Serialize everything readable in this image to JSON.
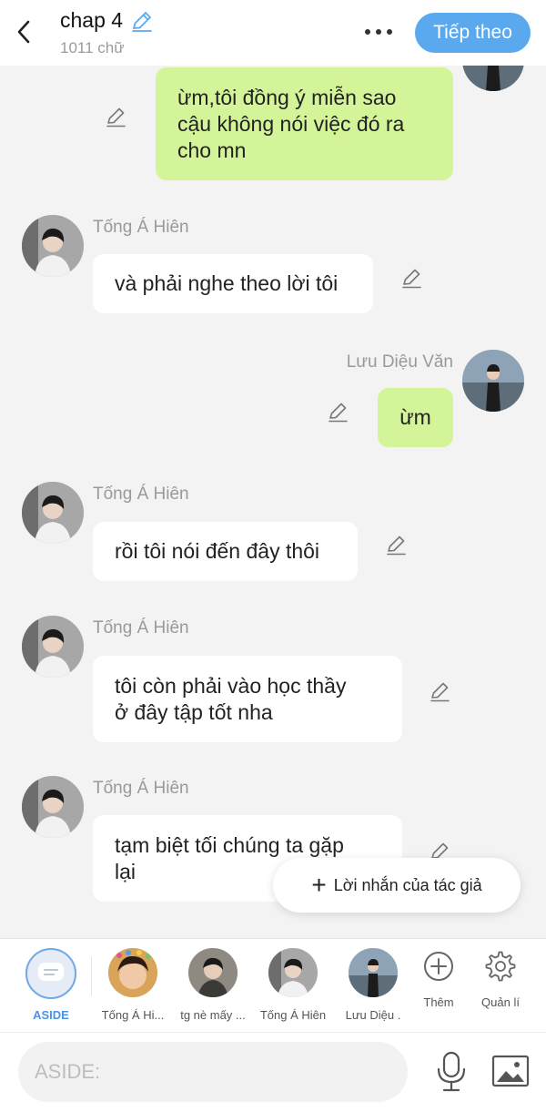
{
  "header": {
    "title": "chap 4",
    "word_count": "1011 chữ",
    "next_label": "Tiếp theo"
  },
  "messages": [
    {
      "side": "right",
      "sender": "",
      "text": "ừm,tôi đồng ý miễn sao\ncậu không nói việc đó ra\ncho mn"
    },
    {
      "side": "left",
      "sender": "Tống Á Hiên",
      "text": "và phải nghe theo lời tôi"
    },
    {
      "side": "right",
      "sender": "Lưu Diệu Văn",
      "text": "ừm"
    },
    {
      "side": "left",
      "sender": "Tống Á Hiên",
      "text": "rồi tôi nói đến đây thôi"
    },
    {
      "side": "left",
      "sender": "Tống Á Hiên",
      "text": "tôi còn phải vào học thầy\nở đây tập tốt nha"
    },
    {
      "side": "left",
      "sender": "Tống Á Hiên",
      "text": "tạm biệt tối chúng ta gặp\nlại"
    }
  ],
  "author_note": {
    "label": "Lời nhắn của tác giả"
  },
  "characters": [
    {
      "label": "ASIDE",
      "icon": "chat-bubble-icon"
    },
    {
      "label": "Tống Á Hi..."
    },
    {
      "label": "tg nè mấy ..."
    },
    {
      "label": "Tống Á Hiên"
    },
    {
      "label": "Lưu Diệu ."
    }
  ],
  "tools": [
    {
      "label": "Thêm",
      "icon": "plus-circle-icon"
    },
    {
      "label": "Quản lí",
      "icon": "gear-icon"
    }
  ],
  "input": {
    "placeholder": "ASIDE:"
  },
  "colors": {
    "accent": "#5aa9ef",
    "right_bubble": "#d4f49a",
    "left_bubble": "#ffffff",
    "background": "#f3f3f3"
  }
}
